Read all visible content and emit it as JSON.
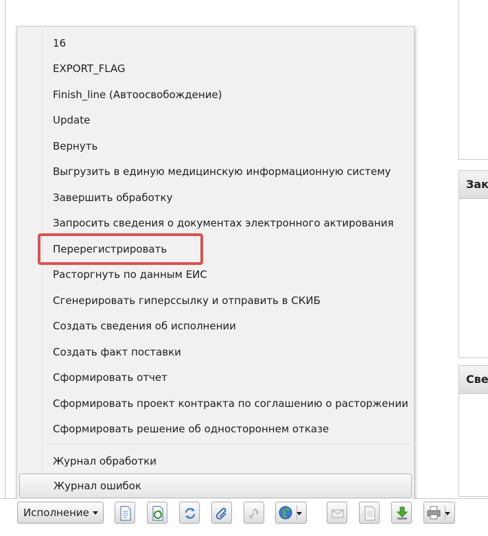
{
  "right_panels": [
    {
      "title": ""
    },
    {
      "title": "Зак"
    },
    {
      "title": "Све"
    }
  ],
  "menu": {
    "items": [
      "16",
      "EXPORT_FLAG",
      "Finish_line (Автоосвобождение)",
      "Update",
      "Вернуть",
      "Выгрузить в единую медицинскую информационную систему",
      "Завершить обработку",
      "Запросить сведения о документах электронного актирования",
      "Перерегистрировать",
      "Расторгнуть по данным ЕИС",
      "Сгенерировать гиперссылку и отправить в СКИБ",
      "Создать сведения об исполнении",
      "Создать факт поставки",
      "Сформировать отчет",
      "Сформировать проект контракта по соглашению о расторжении",
      "Сформировать решение об одностороннем отказе"
    ],
    "footer_items": [
      "Журнал обработки",
      "Журнал ошибок"
    ],
    "highlighted_item": "Перерегистрировать"
  },
  "toolbar": {
    "main_button_label": "Исполнение",
    "icons": [
      "document-icon",
      "document-refresh-icon",
      "refresh-icon",
      "attachment-icon",
      "link-icon",
      "globe-icon",
      "mail-icon",
      "document-gray-icon",
      "download-icon",
      "printer-icon"
    ]
  }
}
